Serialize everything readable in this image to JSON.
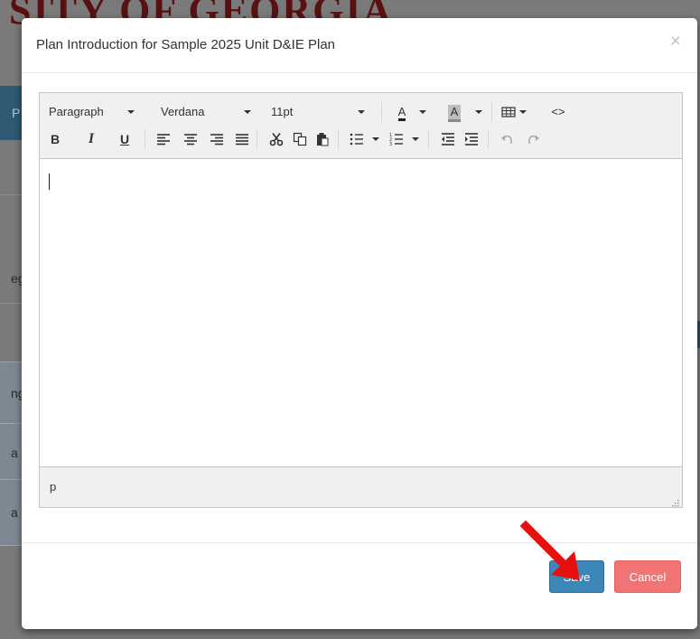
{
  "background": {
    "title": "SITY OF GEORGIA",
    "tab_letter": "P",
    "fragments": [
      "eg",
      "ng",
      "a",
      "a"
    ]
  },
  "modal": {
    "title": "Plan Introduction for Sample 2025 Unit D&IE Plan",
    "close_glyph": "×"
  },
  "editor": {
    "toolbar": {
      "format_select": "Paragraph",
      "font_family_select": "Verdana",
      "font_size_select": "11pt",
      "text_color_icon_label": "A",
      "bg_color_icon_label": "A",
      "source_code_glyph": "<>",
      "bold_label": "B",
      "italic_label": "I",
      "underline_label": "U"
    },
    "content": "",
    "status_path": "p"
  },
  "footer": {
    "save_label": "Save",
    "cancel_label": "Cancel"
  },
  "colors": {
    "primary": "#3d87b8",
    "danger": "#f07474",
    "arrow": "#e8100e"
  }
}
